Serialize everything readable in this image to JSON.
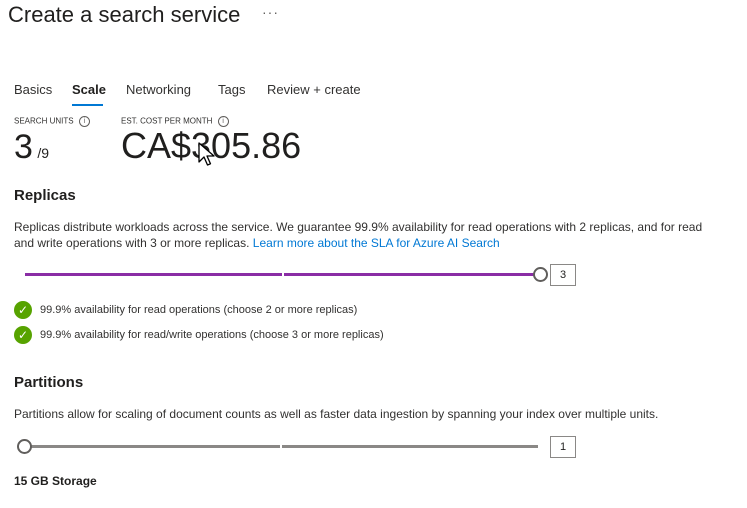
{
  "header": {
    "title": "Create a search service",
    "more": "···"
  },
  "tabs": [
    {
      "label": "Basics"
    },
    {
      "label": "Scale"
    },
    {
      "label": "Networking"
    },
    {
      "label": "Tags"
    },
    {
      "label": "Review + create"
    }
  ],
  "active_tab": "Scale",
  "metrics": {
    "search_units_label": "SEARCH UNITS",
    "search_units_value": "3",
    "search_units_max": "/9",
    "cost_label": "EST. COST PER MONTH",
    "cost_value": "CA$305.86",
    "info_glyph": "i"
  },
  "replicas": {
    "heading": "Replicas",
    "description": "Replicas distribute workloads across the service. We guarantee 99.9% availability for read operations with 2 replicas, and for read and write operations with 3 or more replicas.",
    "link": "Learn more about the SLA for Azure AI Search",
    "value": "3",
    "fill_fraction": 1.0,
    "checks": [
      "99.9% availability for read operations (choose 2 or more replicas)",
      "99.9% availability for read/write operations (choose 3 or more replicas)"
    ]
  },
  "partitions": {
    "heading": "Partitions",
    "description": "Partitions allow for scaling of document counts as well as faster data ingestion by spanning your index over multiple units.",
    "value": "1",
    "fill_fraction": 0.0,
    "storage": "15 GB Storage"
  },
  "colors": {
    "accent": "#0078d4",
    "slider_fill": "#8a2da5",
    "success": "#57a300"
  }
}
